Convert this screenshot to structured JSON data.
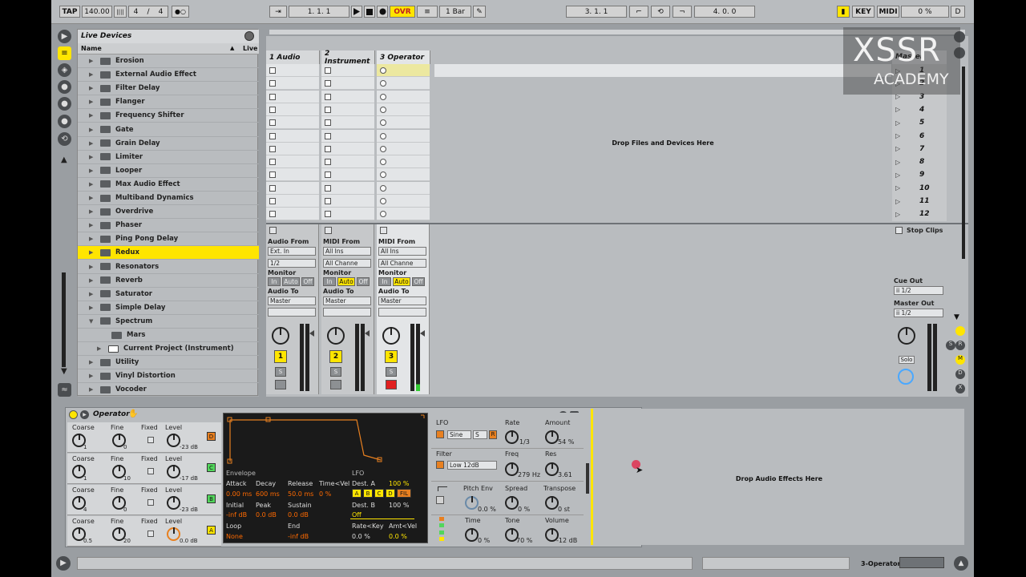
{
  "colors": {
    "accent": "#ffe500",
    "orange": "#e88020",
    "envelope_bg": "#1a1a1a",
    "watermark": "#ff3030"
  },
  "transport": {
    "tap": "TAP",
    "bpm": "140.00",
    "bars_icon": "||||",
    "meter_num": "4",
    "meter_slash": "/",
    "meter_den": "4",
    "metronome": "●○",
    "follow": "⇥",
    "position": "1.  1.  1",
    "ovr": "OVR",
    "quantize": "1 Bar",
    "loop_start": "3.  1.  1",
    "loop_length": "4.  0.  0",
    "key": "KEY",
    "midi": "MIDI",
    "cpu": "0 %",
    "d_label": "D"
  },
  "watermark": {
    "line1": "XSSR",
    "line2": "ACADEMY"
  },
  "browser": {
    "title": "Live Devices",
    "col_name": "Name",
    "col_live": "Live",
    "items": [
      {
        "label": "Erosion",
        "type": "folder"
      },
      {
        "label": "External Audio Effect",
        "type": "folder"
      },
      {
        "label": "Filter Delay",
        "type": "folder"
      },
      {
        "label": "Flanger",
        "type": "folder"
      },
      {
        "label": "Frequency Shifter",
        "type": "folder"
      },
      {
        "label": "Gate",
        "type": "folder"
      },
      {
        "label": "Grain Delay",
        "type": "folder"
      },
      {
        "label": "Limiter",
        "type": "folder"
      },
      {
        "label": "Looper",
        "type": "folder"
      },
      {
        "label": "Max Audio Effect",
        "type": "folder"
      },
      {
        "label": "Multiband Dynamics",
        "type": "folder"
      },
      {
        "label": "Overdrive",
        "type": "folder"
      },
      {
        "label": "Phaser",
        "type": "folder"
      },
      {
        "label": "Ping Pong Delay",
        "type": "folder"
      },
      {
        "label": "Redux",
        "type": "folder",
        "selected": true
      },
      {
        "label": "Resonators",
        "type": "folder"
      },
      {
        "label": "Reverb",
        "type": "folder"
      },
      {
        "label": "Saturator",
        "type": "folder"
      },
      {
        "label": "Simple Delay",
        "type": "folder"
      },
      {
        "label": "Spectrum",
        "type": "folder",
        "expanded": true
      },
      {
        "label": "Mars",
        "type": "subfolder"
      },
      {
        "label": "Current Project (Instrument)",
        "type": "preset"
      },
      {
        "label": "Utility",
        "type": "folder"
      },
      {
        "label": "Vinyl Distortion",
        "type": "folder"
      },
      {
        "label": "Vocoder",
        "type": "folder"
      }
    ]
  },
  "session": {
    "tracks": [
      {
        "name": "1 Audio",
        "io_from_label": "Audio From",
        "io_from": "Ext. In",
        "io_ch": "1/2",
        "number": "1"
      },
      {
        "name": "2 Instrument",
        "io_from_label": "MIDI From",
        "io_from": "All Ins",
        "io_ch": "All Channe",
        "number": "2"
      },
      {
        "name": "3 Operator",
        "io_from_label": "MIDI From",
        "io_from": "All Ins",
        "io_ch": "All Channe",
        "number": "3"
      }
    ],
    "master_name": "Master",
    "drop_text": "Drop Files and Devices Here",
    "scenes": [
      "1",
      "2",
      "3",
      "4",
      "5",
      "6",
      "7",
      "8",
      "9",
      "10",
      "11",
      "12"
    ],
    "stop_clips": "Stop Clips",
    "monitor_label": "Monitor",
    "monitor_in": "In",
    "monitor_auto": "Auto",
    "monitor_off": "Off",
    "audio_to_label": "Audio To",
    "audio_to": "Master",
    "solo_btn": "S",
    "cue_out_label": "Cue Out",
    "cue_out": "ii 1/2",
    "master_out_label": "Master Out",
    "master_out": "ii 1/2",
    "solo_label": "Solo"
  },
  "device": {
    "title": "Operator",
    "osc_rows": [
      {
        "coarse": "1",
        "fine": "0",
        "level": "-23 dB",
        "letter": "D",
        "color": "#e88020"
      },
      {
        "coarse": "1",
        "fine": "10",
        "level": "-17 dB",
        "letter": "C",
        "color": "#52d65c"
      },
      {
        "coarse": "4",
        "fine": "0",
        "level": "-23 dB",
        "letter": "B",
        "color": "#52d65c"
      },
      {
        "coarse": "0.5",
        "fine": "20",
        "level": "0.0 dB",
        "letter": "A",
        "color": "#ffe500"
      }
    ],
    "col_coarse": "Coarse",
    "col_fine": "Fine",
    "col_fixed": "Fixed",
    "col_level": "Level",
    "envelope": {
      "title": "Envelope",
      "attack_label": "Attack",
      "attack": "0.00 ms",
      "decay_label": "Decay",
      "decay": "600 ms",
      "release_label": "Release",
      "release": "50.0 ms",
      "timevel_label": "Time<Vel",
      "timevel": "0 %",
      "initial_label": "Initial",
      "initial": "-inf dB",
      "peak_label": "Peak",
      "peak": "0.0 dB",
      "sustain_label": "Sustain",
      "sustain": "0.0 dB",
      "loop_label": "Loop",
      "loop": "None",
      "end_label": "End",
      "end": "-inf dB",
      "lfo_title": "LFO",
      "dest_a_label": "Dest. A",
      "dest_a": "100 %",
      "dest_buttons": [
        "A",
        "B",
        "C",
        "D",
        "FIL"
      ],
      "dest_b_label": "Dest. B",
      "dest_b_pct": "100 %",
      "dest_b": "Off",
      "ratekey_label": "Rate<Key",
      "ratekey": "0.0 %",
      "amtvel_label": "Amt<Vel",
      "amtvel": "0.0 %"
    },
    "lfo": {
      "label": "LFO",
      "wave": "Sine",
      "sync": "S",
      "retrig": "R",
      "rate_label": "Rate",
      "rate": "1/3",
      "amount_label": "Amount",
      "amount": "54 %"
    },
    "filter": {
      "label": "Filter",
      "type": "Low 12dB",
      "freq_label": "Freq",
      "freq": "279 Hz",
      "res_label": "Res",
      "res": "3.61"
    },
    "pitch": {
      "pitch_env_label": "Pitch Env",
      "pitch_env": "0.0 %",
      "spread_label": "Spread",
      "spread": "0 %",
      "transpose_label": "Transpose",
      "transpose": "0 st"
    },
    "global": {
      "time_label": "Time",
      "time": "0 %",
      "tone_label": "Tone",
      "tone": "70 %",
      "volume_label": "Volume",
      "volume": "-12 dB"
    },
    "drop_effects": "Drop Audio Effects Here"
  },
  "status": {
    "track_name": "3-Operator"
  }
}
